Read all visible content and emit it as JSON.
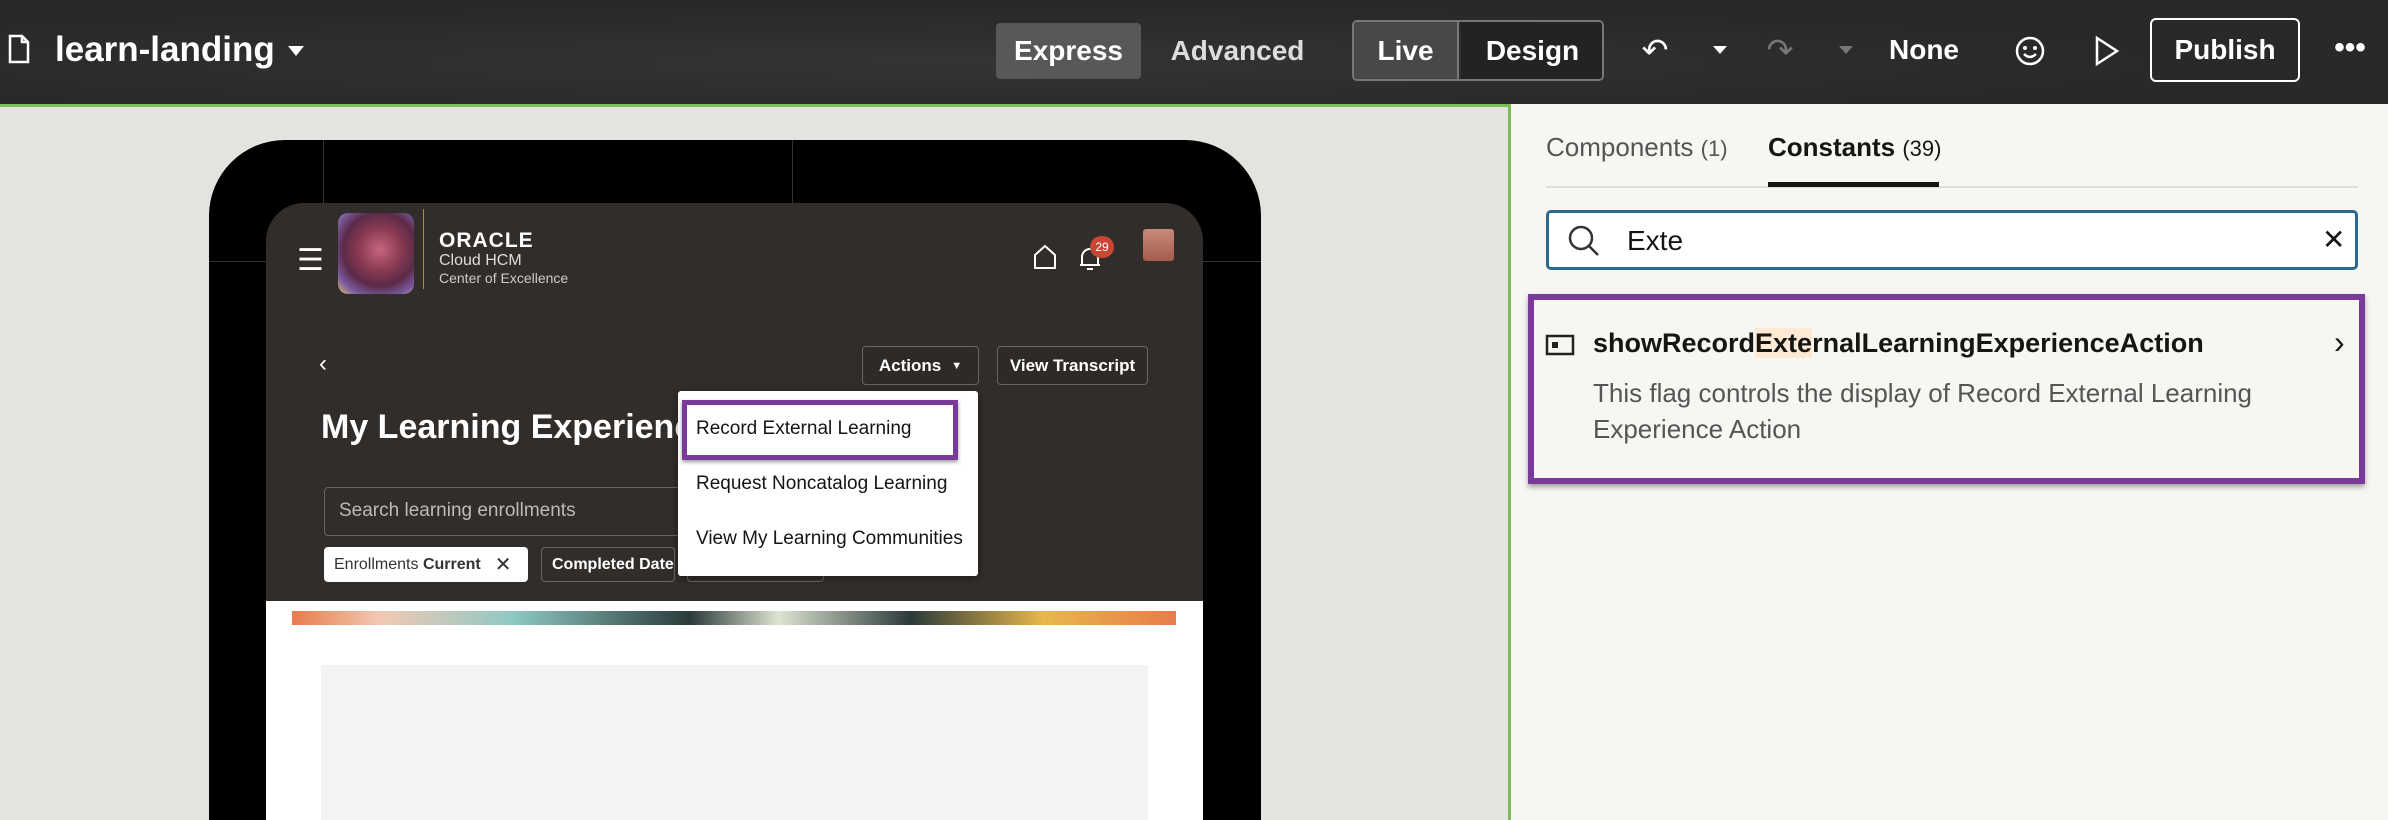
{
  "header": {
    "page_name": "learn-landing",
    "express": "Express",
    "advanced": "Advanced",
    "live": "Live",
    "design": "Design",
    "environment": "None",
    "publish": "Publish"
  },
  "app": {
    "brand": "ORACLE",
    "product": "Cloud HCM",
    "subtitle": "Center of Excellence",
    "notification_count": "29",
    "page_title": "My Learning Experienc",
    "actions": "Actions",
    "view_transcript": "View Transcript",
    "search_placeholder": "Search learning enrollments",
    "chips": {
      "enrollments_label": "Enrollments",
      "enrollments_value": "Current",
      "completed_date": "Completed Date"
    },
    "menu": [
      "Record External Learning",
      "Request Noncatalog Learning",
      "View My Learning Communities"
    ]
  },
  "panel": {
    "tabs": [
      {
        "label": "Components",
        "count": "(1)"
      },
      {
        "label": "Constants",
        "count": "(39)"
      }
    ],
    "search_value": "Exte",
    "result": {
      "name_pre": "showRecord",
      "name_match": "Exte",
      "name_post": "rnalLearningExperienceAction",
      "description": "This flag controls the display of Record External Learning Experience Action"
    }
  },
  "colors": {
    "highlight": "#7a3a9a",
    "accent_green": "#7cbd5a",
    "search_border": "#2b6c8c",
    "badge": "#c74634"
  }
}
